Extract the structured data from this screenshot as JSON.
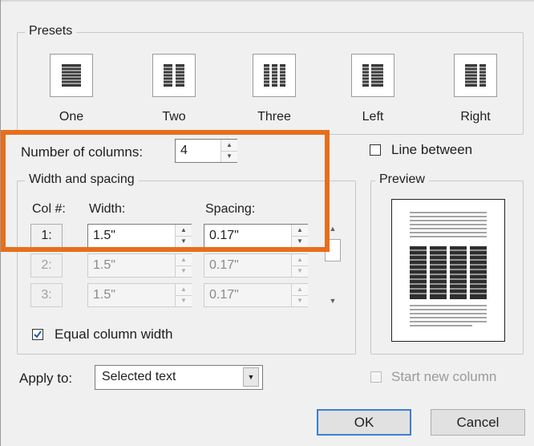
{
  "presets": {
    "group_label": "Presets",
    "items": [
      {
        "label": "One"
      },
      {
        "label": "Two"
      },
      {
        "label": "Three"
      },
      {
        "label": "Left"
      },
      {
        "label": "Right"
      }
    ]
  },
  "number_of_columns": {
    "label": "Number of columns:",
    "value": "4"
  },
  "line_between": {
    "label": "Line between",
    "checked": false
  },
  "width_spacing": {
    "group_label": "Width and spacing",
    "col_header": "Col #:",
    "width_header": "Width:",
    "spacing_header": "Spacing:",
    "rows": [
      {
        "col": "1:",
        "width": "1.5\"",
        "spacing": "0.17\"",
        "enabled": true
      },
      {
        "col": "2:",
        "width": "1.5\"",
        "spacing": "0.17\"",
        "enabled": false
      },
      {
        "col": "3:",
        "width": "1.5\"",
        "spacing": "0.17\"",
        "enabled": false
      }
    ]
  },
  "equal_column_width": {
    "label": "Equal column width",
    "checked": true
  },
  "preview": {
    "group_label": "Preview"
  },
  "apply_to": {
    "label": "Apply to:",
    "value": "Selected text"
  },
  "start_new_column": {
    "label": "Start new column",
    "checked": false
  },
  "buttons": {
    "ok": "OK",
    "cancel": "Cancel"
  },
  "colors": {
    "highlight": "#e86e1c",
    "default_button_border": "#3c7fd4"
  }
}
